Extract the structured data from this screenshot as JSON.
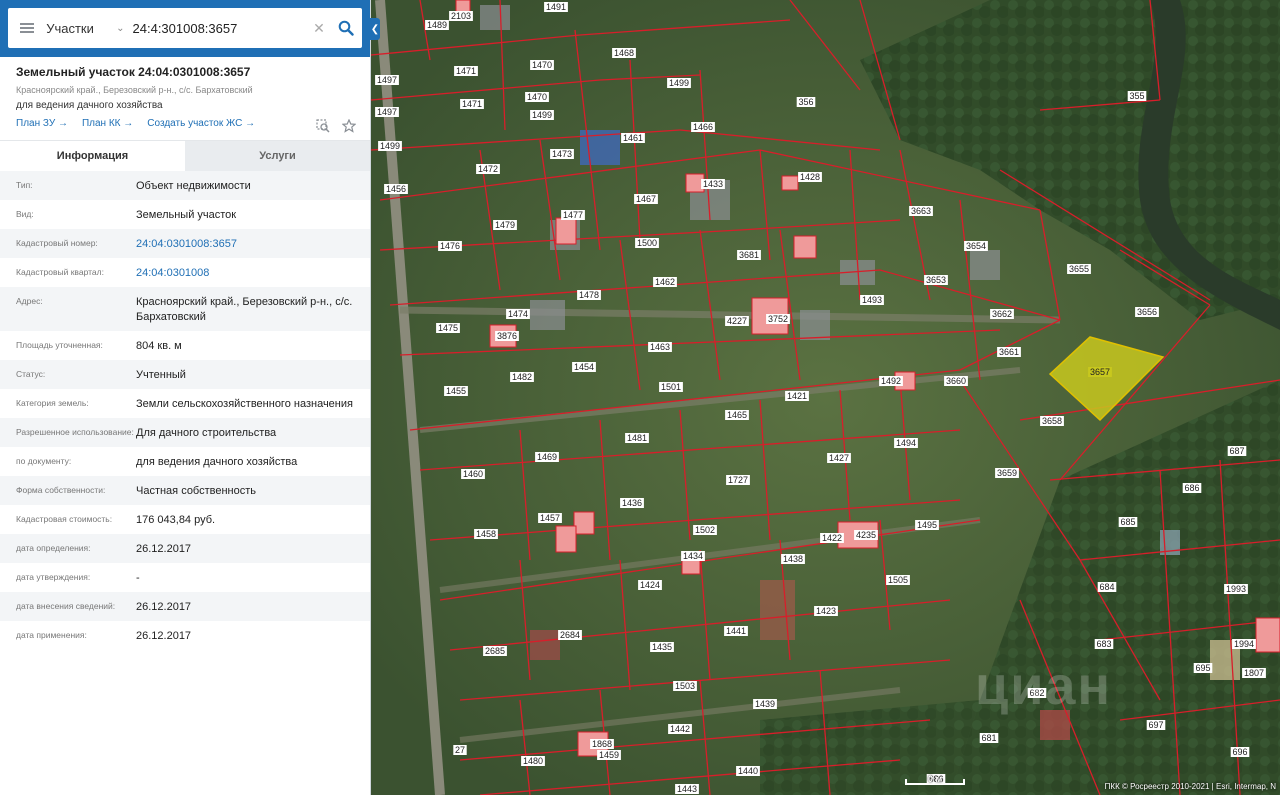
{
  "search": {
    "layer": "Участки",
    "query": "24:4:301008:3657"
  },
  "object": {
    "title": "Земельный участок 24:04:0301008:3657",
    "address_short": "Красноярский край., Березовский р-н., с/с. Бархатовский",
    "purpose": "для ведения дачного хозяйства",
    "links": [
      "План ЗУ →",
      "План КК →",
      "Создать участок ЖС →"
    ]
  },
  "tabs": [
    {
      "label": "Информация",
      "active": true
    },
    {
      "label": "Услуги",
      "active": false
    }
  ],
  "info": [
    {
      "label": "Тип:",
      "value": "Объект недвижимости"
    },
    {
      "label": "Вид:",
      "value": "Земельный участок"
    },
    {
      "label": "Кадастровый номер:",
      "value": "24:04:0301008:3657",
      "link": true
    },
    {
      "label": "Кадастровый квартал:",
      "value": "24:04:0301008",
      "link": true
    },
    {
      "label": "Адрес:",
      "value": "Красноярский край., Березовский р-н., с/с. Бархатовский"
    },
    {
      "label": "Площадь уточненная:",
      "value": "804 кв. м"
    },
    {
      "label": "Статус:",
      "value": "Учтенный"
    },
    {
      "label": "Категория земель:",
      "value": "Земли сельскохозяйственного назначения"
    },
    {
      "label": "Разрешенное использование:",
      "value": "Для дачного строительства"
    },
    {
      "label": "по документу:",
      "value": "для ведения дачного хозяйства"
    },
    {
      "label": "Форма собственности:",
      "value": "Частная собственность"
    },
    {
      "label": "Кадастровая стоимость:",
      "value": "176 043,84 руб."
    },
    {
      "label": "дата определения:",
      "value": "26.12.2017"
    },
    {
      "label": "дата утверждения:",
      "value": "-"
    },
    {
      "label": "дата внесения сведений:",
      "value": "26.12.2017"
    },
    {
      "label": "дата применения:",
      "value": "26.12.2017"
    }
  ],
  "map": {
    "selected_parcel": "3657",
    "highlight_color": "#c8c81e",
    "boundary_color": "#d81e2a",
    "parcel_labels": [
      "1489",
      "2103",
      "1491",
      "1497",
      "1471",
      "1470",
      "1468",
      "1499",
      "356",
      "355",
      "1497",
      "1471",
      "1470",
      "1499",
      "1466",
      "1499",
      "1473",
      "1461",
      "1456",
      "1472",
      "1433",
      "1428",
      "1467",
      "1479",
      "1477",
      "3663",
      "1476",
      "1500",
      "3681",
      "3654",
      "3655",
      "1478",
      "1462",
      "3653",
      "1493",
      "1475",
      "1474",
      "3876",
      "4227",
      "3752",
      "3662",
      "3656",
      "1463",
      "3661",
      "1455",
      "1482",
      "1454",
      "1501",
      "1492",
      "3660",
      "3657",
      "1421",
      "1465",
      "3658",
      "1481",
      "1494",
      "1460",
      "1469",
      "1727",
      "1427",
      "3659",
      "1436",
      "1457",
      "1458",
      "1502",
      "1495",
      "1422",
      "4235",
      "1438",
      "1434",
      "1424",
      "1505",
      "1423",
      "2684",
      "1441",
      "2685",
      "1435",
      "1503",
      "1439",
      "1442",
      "1480",
      "1459",
      "1868",
      "1440",
      "1443",
      "687",
      "686",
      "685",
      "684",
      "683",
      "682",
      "681",
      "695",
      "697",
      "696",
      "1993",
      "1994",
      "1807",
      "27",
      "686"
    ],
    "scale": "0 м",
    "attribution": "ПКК © Росреестр 2010-2021 | Esri, Intermap, N",
    "watermark": "циан"
  }
}
